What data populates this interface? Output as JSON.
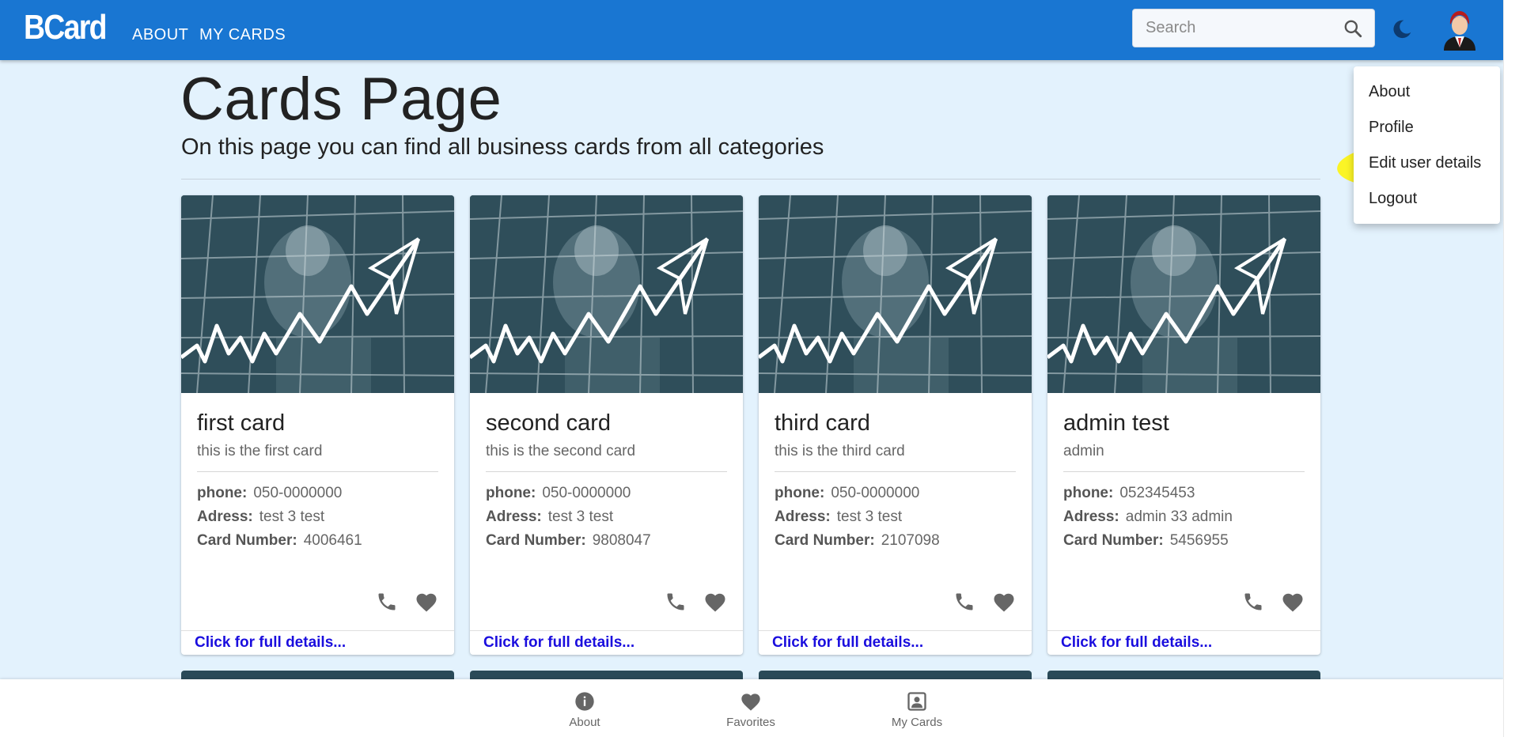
{
  "app": {
    "logo": "BCard",
    "nav": [
      {
        "label": "ABOUT"
      },
      {
        "label": "MY CARDS"
      }
    ],
    "search": {
      "placeholder": "Search",
      "value": ""
    },
    "icons": {
      "search": "search-icon",
      "theme": "moon-icon",
      "avatar": "avatar-icon"
    },
    "colors": {
      "appbar": "#1976d2",
      "background": "#e3f2fd",
      "link": "#1a0dde",
      "highlight": "#fff500"
    }
  },
  "page": {
    "title": "Cards Page",
    "subtitle": "On this page you can find all business cards from all categories"
  },
  "cards": [
    {
      "title": "first card",
      "subtitle": "this is the first card",
      "phone_label": "phone:",
      "phone": "050-0000000",
      "address_label": "Adress:",
      "address": "test 3 test",
      "number_label": "Card Number:",
      "number": "4006461",
      "link": "Click for full details..."
    },
    {
      "title": "second card",
      "subtitle": "this is the second card",
      "phone_label": "phone:",
      "phone": "050-0000000",
      "address_label": "Adress:",
      "address": "test 3 test",
      "number_label": "Card Number:",
      "number": "9808047",
      "link": "Click for full details..."
    },
    {
      "title": "third card",
      "subtitle": "this is the third card",
      "phone_label": "phone:",
      "phone": "050-0000000",
      "address_label": "Adress:",
      "address": "test 3 test",
      "number_label": "Card Number:",
      "number": "2107098",
      "link": "Click for full details..."
    },
    {
      "title": "admin test",
      "subtitle": "admin",
      "phone_label": "phone:",
      "phone": "052345453",
      "address_label": "Adress:",
      "address": "admin 33 admin",
      "number_label": "Card Number:",
      "number": "5456955",
      "link": "Click for full details..."
    }
  ],
  "user_menu": {
    "items": [
      {
        "label": "About"
      },
      {
        "label": "Profile"
      },
      {
        "label": "Edit user details"
      },
      {
        "label": "Logout"
      }
    ]
  },
  "bottom_nav": [
    {
      "label": "About",
      "icon": "info-icon"
    },
    {
      "label": "Favorites",
      "icon": "heart-icon"
    },
    {
      "label": "My Cards",
      "icon": "contact-card-icon"
    }
  ]
}
